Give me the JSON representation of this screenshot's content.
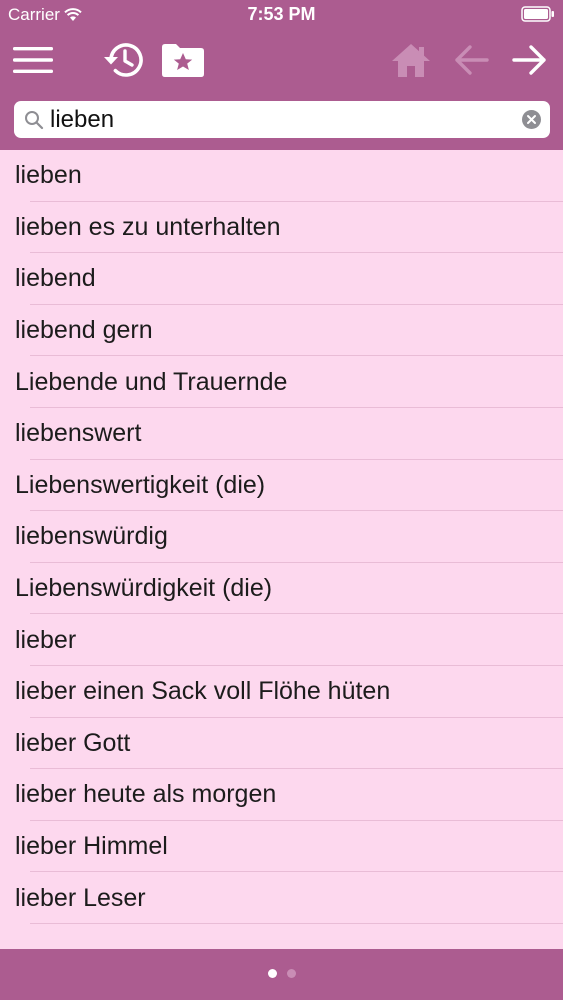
{
  "status_bar": {
    "carrier": "Carrier",
    "time": "7:53 PM"
  },
  "toolbar": {
    "icons": [
      "menu-icon",
      "history-icon",
      "favorites-folder-icon",
      "home-icon",
      "back-arrow-icon",
      "forward-arrow-icon"
    ],
    "disabled_icons": [
      "home-icon",
      "back-arrow-icon"
    ]
  },
  "search": {
    "value": "lieben",
    "icons": [
      "search-icon",
      "clear-icon"
    ]
  },
  "results": [
    "lieben",
    "lieben es zu unterhalten",
    "liebend",
    "liebend gern",
    "Liebende und Trauernde",
    "liebenswert",
    "Liebenswertigkeit (die)",
    "liebenswürdig",
    "Liebenswürdigkeit (die)",
    "lieber",
    "lieber einen Sack voll Flöhe hüten",
    "lieber Gott",
    "lieber heute als morgen",
    "lieber Himmel",
    "lieber Leser"
  ],
  "pager": {
    "total_pages": 2,
    "current_page": 1
  },
  "colors": {
    "bar": "#ac5c90",
    "list_background": "#fdd8ee",
    "separator": "#e9bcd6",
    "icon_active": "#ffffff",
    "icon_disabled": "#c98db5"
  }
}
